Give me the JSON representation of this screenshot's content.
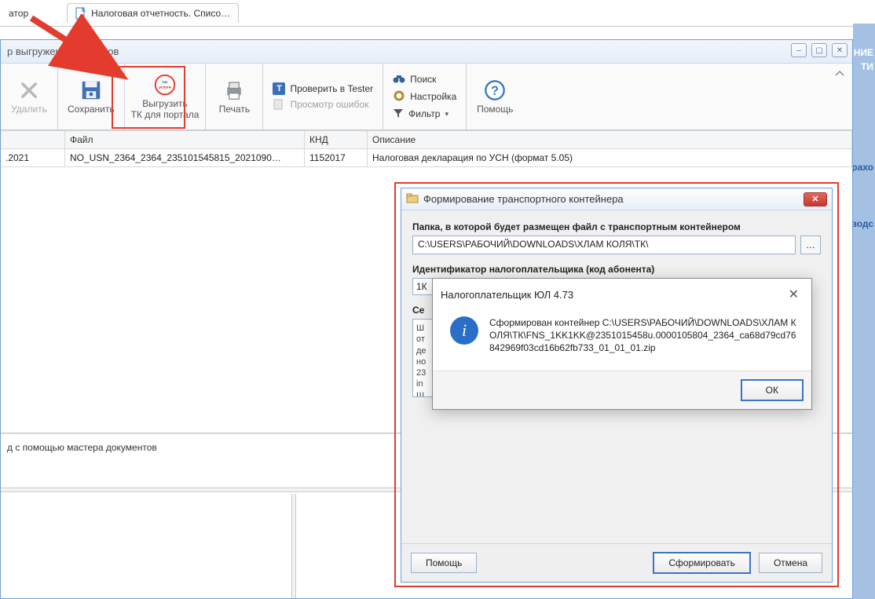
{
  "tabs": {
    "nav": "атор",
    "active": "Налоговая отчетность. Списо…"
  },
  "mdi": {
    "title": "р выгруженных файлов",
    "winbtns": {
      "min": "–",
      "max": "▢",
      "close": "✕"
    }
  },
  "toolbar": {
    "delete": "Удалить",
    "save": "Сохранить",
    "export_line1": "Выгрузить",
    "export_line2": "ТК для портала",
    "print": "Печать",
    "tester": "Проверить в Tester",
    "view_errors": "Просмотр ошибок",
    "search": "Поиск",
    "settings": "Настройка",
    "filter": "Фильтр",
    "help": "Помощь"
  },
  "grid": {
    "headers": {
      "date": ".2021",
      "file": "Файл",
      "knd": "КНД",
      "desc": "Описание"
    },
    "row": {
      "date": ".2021",
      "file": "NO_USN_2364_2364_235101545815_2021090…",
      "knd": "1152017",
      "desc": "Налоговая декларация по УСН (формат 5.05)"
    }
  },
  "hint": "д с помощью мастера документов",
  "dialog": {
    "title": "Формирование транспортного контейнера",
    "folder_label": "Папка, в которой будет размещен файл с транспортным контейнером",
    "folder_value": "C:\\USERS\\РАБОЧИЙ\\DOWNLOADS\\ХЛАМ КОЛЯ\\ТК\\",
    "browse": "…",
    "id_label_cut": "Идентификатор налогоплательщика (код абонента)",
    "id_value_cut": "1К",
    "cert_label_cut": "Се",
    "cert_text_cut": "Ш\nот\nде\nно\n23\nin\nШ",
    "btn_help": "Помощь",
    "btn_form": "Сформировать",
    "btn_cancel": "Отмена"
  },
  "msgbox": {
    "title": "Налогоплательщик ЮЛ 4.73",
    "text": "Сформирован контейнер C:\\USERS\\РАБОЧИЙ\\DOWNLOADS\\ХЛАМ КОЛЯ\\ТК\\FNS_1KK1KK@2351015458u.0000105804_2364_ca68d79cd76842969f03cd16b62fb733_01_01_01.zip",
    "ok": "ОК"
  },
  "rightfrag": {
    "a": "НИЕ",
    "b": "ТИ",
    "c": "рахо",
    "d": "водс"
  }
}
